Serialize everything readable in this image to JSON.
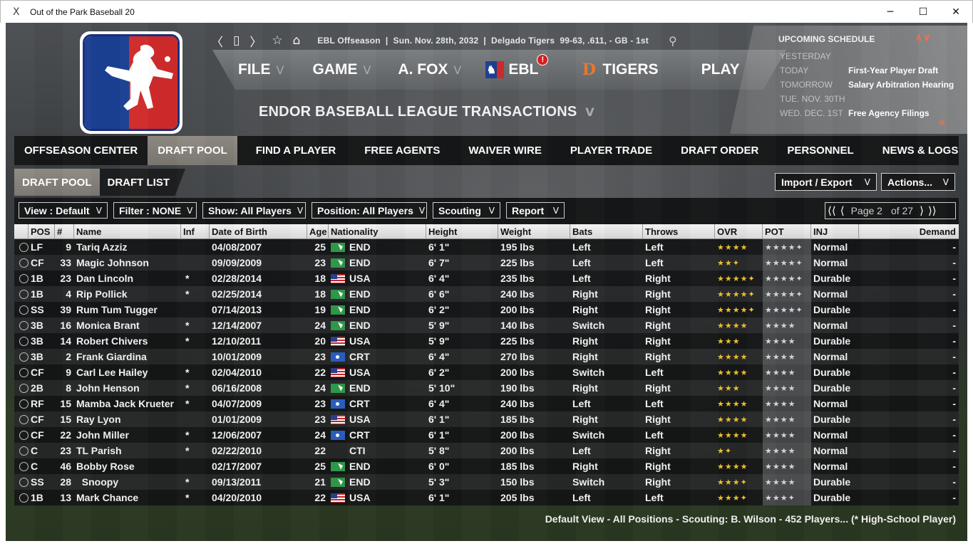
{
  "window": {
    "title": "Out of the Park Baseball 20",
    "icon_glyph": "Ⅹ",
    "min_glyph": "─",
    "max_glyph": "☐",
    "close_glyph": "✕"
  },
  "topbar": {
    "back_glyph": "〈",
    "page_glyph": "▯",
    "forward_glyph": "〉",
    "star_glyph": "☆",
    "home_glyph": "⌂",
    "status": "EBL Offseason  |  Sun. Nov. 28th, 2032  |  Delgado Tigers  99-63, .611, - GB - 1st",
    "search_glyph": "⚲"
  },
  "menu": {
    "file": "FILE",
    "game": "GAME",
    "manager": "A. FOX",
    "league": "EBL",
    "league_alert": "!",
    "team": "TIGERS",
    "play": "PLAY",
    "caret": "V",
    "team_logo_glyph": "D",
    "league_logo_glyph": "♞"
  },
  "section_title": "ENDOR BASEBALL LEAGUE TRANSACTIONS",
  "section_caret": "V",
  "schedule": {
    "title": "UPCOMING SCHEDULE",
    "arrows": "∧∨",
    "back": "«",
    "rows": [
      {
        "day": "YESTERDAY",
        "event": ""
      },
      {
        "day": "TODAY",
        "event": "First-Year Player Draft"
      },
      {
        "day": "TOMORROW",
        "event": "Salary Arbitration Hearing"
      },
      {
        "day": "TUE. NOV. 30TH",
        "event": ""
      },
      {
        "day": "WED. DEC. 1ST",
        "event": "Free Agency Filings"
      }
    ]
  },
  "tabs": [
    "OFFSEASON CENTER",
    "DRAFT POOL",
    "FIND A PLAYER",
    "FREE AGENTS",
    "WAIVER WIRE",
    "PLAYER TRADE",
    "DRAFT ORDER",
    "PERSONNEL",
    "NEWS & LOGS"
  ],
  "subtabs": [
    "DRAFT POOL",
    "DRAFT LIST"
  ],
  "actions": {
    "import_export": "Import / Export",
    "actions": "Actions...",
    "caret": "V"
  },
  "filters": {
    "view": "View : Default",
    "filter": "Filter : NONE",
    "show": "Show: All Players",
    "position": "Position: All Players",
    "scouting": "Scouting",
    "report": "Report",
    "caret": "V"
  },
  "pager": {
    "first": "⟨⟨",
    "prev": "⟨",
    "page_label": "Page 2",
    "of": "of 27",
    "next": "⟩",
    "last": "⟩⟩"
  },
  "columns": [
    "",
    "POS",
    "#",
    "Name",
    "Inf",
    "Date of Birth",
    "Age",
    "Nationality",
    "Height",
    "Weight",
    "Bats",
    "Throws",
    "OVR",
    "POT",
    "INJ",
    "Demand"
  ],
  "rows": [
    {
      "pos": "LF",
      "num": "9",
      "name": "Tariq Azziz",
      "inf": "",
      "dob": "04/08/2007",
      "age": "25",
      "flag": "end",
      "nat": "END",
      "height": "6' 1\"",
      "weight": "195 lbs",
      "bats": "Left",
      "throws": "Left",
      "ovr": "★★★★",
      "pot": "★★★★✦",
      "inj": "Normal",
      "demand": "-"
    },
    {
      "pos": "CF",
      "num": "33",
      "name": "Magic Johnson",
      "inf": "",
      "dob": "09/09/2009",
      "age": "23",
      "flag": "end",
      "nat": "END",
      "height": "6' 7\"",
      "weight": "225 lbs",
      "bats": "Left",
      "throws": "Left",
      "ovr": "★★✦",
      "pot": "★★★★✦",
      "inj": "Normal",
      "demand": "-"
    },
    {
      "pos": "1B",
      "num": "23",
      "name": "Dan Lincoln",
      "inf": "*",
      "dob": "02/28/2014",
      "age": "18",
      "flag": "usa",
      "nat": "USA",
      "height": "6' 4\"",
      "weight": "235 lbs",
      "bats": "Left",
      "throws": "Right",
      "ovr": "★★★★✦",
      "pot": "★★★★✦",
      "inj": "Durable",
      "demand": "-"
    },
    {
      "pos": "1B",
      "num": "4",
      "name": "Rip Pollick",
      "inf": "*",
      "dob": "02/25/2014",
      "age": "18",
      "flag": "end",
      "nat": "END",
      "height": "6' 6\"",
      "weight": "240 lbs",
      "bats": "Right",
      "throws": "Right",
      "ovr": "★★★★✦",
      "pot": "★★★★✦",
      "inj": "Normal",
      "demand": "-"
    },
    {
      "pos": "SS",
      "num": "39",
      "name": "Rum Tum Tugger",
      "inf": "",
      "dob": "07/14/2013",
      "age": "19",
      "flag": "end",
      "nat": "END",
      "height": "6' 2\"",
      "weight": "200 lbs",
      "bats": "Right",
      "throws": "Right",
      "ovr": "★★★★✦",
      "pot": "★★★★✦",
      "inj": "Durable",
      "demand": "-"
    },
    {
      "pos": "3B",
      "num": "16",
      "name": "Monica Brant",
      "inf": "*",
      "dob": "12/14/2007",
      "age": "24",
      "flag": "end",
      "nat": "END",
      "height": "5' 9\"",
      "weight": "140 lbs",
      "bats": "Switch",
      "throws": "Right",
      "ovr": "★★★★",
      "pot": "★★★★",
      "inj": "Normal",
      "demand": "-"
    },
    {
      "pos": "3B",
      "num": "14",
      "name": "Robert Chivers",
      "inf": "*",
      "dob": "12/10/2011",
      "age": "20",
      "flag": "usa",
      "nat": "USA",
      "height": "5' 9\"",
      "weight": "225 lbs",
      "bats": "Right",
      "throws": "Right",
      "ovr": "★★★",
      "pot": "★★★★",
      "inj": "Durable",
      "demand": "-"
    },
    {
      "pos": "3B",
      "num": "2",
      "name": "Frank Giardina",
      "inf": "",
      "dob": "10/01/2009",
      "age": "23",
      "flag": "crt",
      "nat": "CRT",
      "height": "6' 4\"",
      "weight": "270 lbs",
      "bats": "Right",
      "throws": "Right",
      "ovr": "★★★★",
      "pot": "★★★★",
      "inj": "Normal",
      "demand": "-"
    },
    {
      "pos": "CF",
      "num": "9",
      "name": "Carl Lee Hailey",
      "inf": "*",
      "dob": "02/04/2010",
      "age": "22",
      "flag": "usa",
      "nat": "USA",
      "height": "6' 2\"",
      "weight": "200 lbs",
      "bats": "Switch",
      "throws": "Left",
      "ovr": "★★★★",
      "pot": "★★★★",
      "inj": "Durable",
      "demand": "-"
    },
    {
      "pos": "2B",
      "num": "8",
      "name": "John Henson",
      "inf": "*",
      "dob": "06/16/2008",
      "age": "24",
      "flag": "end",
      "nat": "END",
      "height": "5' 10\"",
      "weight": "190 lbs",
      "bats": "Right",
      "throws": "Right",
      "ovr": "★★★",
      "pot": "★★★★",
      "inj": "Durable",
      "demand": "-"
    },
    {
      "pos": "RF",
      "num": "15",
      "name": "Mamba Jack Krueter",
      "inf": "*",
      "dob": "04/07/2009",
      "age": "23",
      "flag": "crt",
      "nat": "CRT",
      "height": "6' 4\"",
      "weight": "240 lbs",
      "bats": "Left",
      "throws": "Left",
      "ovr": "★★★★",
      "pot": "★★★★",
      "inj": "Normal",
      "demand": "-"
    },
    {
      "pos": "CF",
      "num": "15",
      "name": "Ray Lyon",
      "inf": "",
      "dob": "01/01/2009",
      "age": "23",
      "flag": "usa",
      "nat": "USA",
      "height": "6' 1\"",
      "weight": "185 lbs",
      "bats": "Right",
      "throws": "Right",
      "ovr": "★★★★",
      "pot": "★★★★",
      "inj": "Durable",
      "demand": "-"
    },
    {
      "pos": "CF",
      "num": "22",
      "name": "John Miller",
      "inf": "*",
      "dob": "12/06/2007",
      "age": "24",
      "flag": "crt",
      "nat": "CRT",
      "height": "6' 1\"",
      "weight": "200 lbs",
      "bats": "Switch",
      "throws": "Left",
      "ovr": "★★★★",
      "pot": "★★★★",
      "inj": "Normal",
      "demand": "-"
    },
    {
      "pos": "C",
      "num": "23",
      "name": "TL Parish",
      "inf": "*",
      "dob": "02/22/2010",
      "age": "22",
      "flag": "cti",
      "nat": "CTI",
      "height": "5' 8\"",
      "weight": "200 lbs",
      "bats": "Left",
      "throws": "Right",
      "ovr": "★✦",
      "pot": "★★★★",
      "inj": "Normal",
      "demand": "-"
    },
    {
      "pos": "C",
      "num": "46",
      "name": "Bobby Rose",
      "inf": "",
      "dob": "02/17/2007",
      "age": "25",
      "flag": "end",
      "nat": "END",
      "height": "6' 0\"",
      "weight": "185 lbs",
      "bats": "Right",
      "throws": "Right",
      "ovr": "★★★★",
      "pot": "★★★★",
      "inj": "Normal",
      "demand": "-"
    },
    {
      "pos": "SS",
      "num": "28",
      "name": "  Snoopy",
      "inf": "*",
      "dob": "09/13/2011",
      "age": "21",
      "flag": "end",
      "nat": "END",
      "height": "5' 3\"",
      "weight": "150 lbs",
      "bats": "Switch",
      "throws": "Right",
      "ovr": "★★★✦",
      "pot": "★★★★",
      "inj": "Durable",
      "demand": "-"
    },
    {
      "pos": "1B",
      "num": "13",
      "name": "Mark Chance",
      "inf": "*",
      "dob": "04/20/2010",
      "age": "22",
      "flag": "usa",
      "nat": "USA",
      "height": "6' 1\"",
      "weight": "205 lbs",
      "bats": "Left",
      "throws": "Left",
      "ovr": "★★★✦",
      "pot": "★★★✦",
      "inj": "Durable",
      "demand": "-"
    }
  ],
  "footer": "Default View - All Positions - Scouting: B. Wilson - 452 Players... (* High-School Player)",
  "colors": {
    "accent": "#ff6a3c",
    "stars": "#f2c230",
    "alert": "#d21d1d",
    "tiger_orange": "#e8762a"
  }
}
